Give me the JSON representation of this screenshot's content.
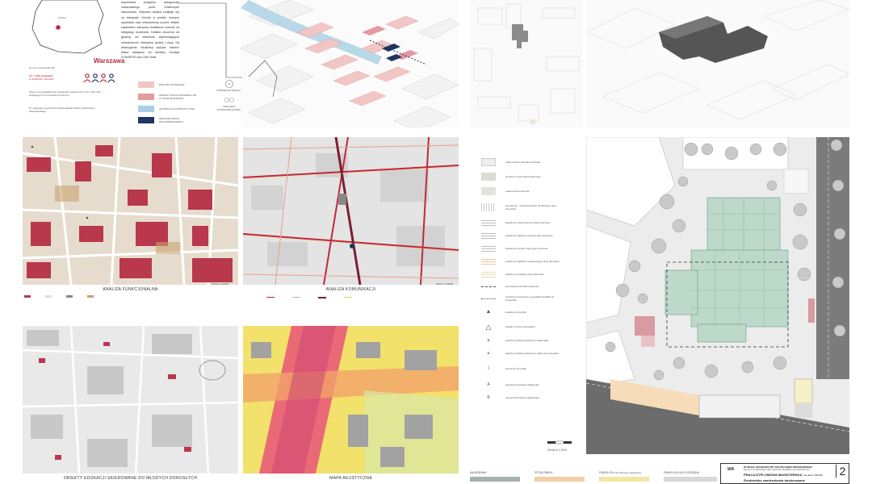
{
  "top_left": {
    "map_label_small": "Ochota",
    "city": "Warszawa",
    "stat_line1": "1k.3 tys. studentów UW",
    "stat_line2": "0,7 - 5,4% studentów",
    "stat_line3": "w spółdzielni członków*",
    "body_text": "dopełnianie programu dostępności realizowanego przez Uniwersytet Warszawski. Wybrana działka znajduje się na kampusie Ochota w pobliżu licznych wydziałów oraz infrastruktury uczelni. Bliskie sąsiedztwo zatrzyma dodatkowo pozwoli na integrację studentów. Działka otoczona od głównej osi założenia zapewniających mieszkańcom niezbędny spokój i ciszę. Na atrakcyjność lokalizacji wpływa również bliska odległość od siedziby fundacji SYNAPSIS oraz Ochi Teatr.",
    "footnote1": "*Dane o demograficznych studentach spadną od 0,7 do 7,5% osób studiujących na uczelniach wyższych.",
    "footnote2": "Dr. odkrywka na przeciwi studiów akademickich Uniwersytetu Warszawskiego.",
    "legend": [
      {
        "label": "BUDYNKI ISTNIEJĄCE",
        "color": "#f3c6c6"
      },
      {
        "label": "INWESTYCJE PLANOWANE LUB W TRAKCIE BUDOWY",
        "color": "#e39aa0"
      },
      {
        "label": "GŁÓWNA OŚ KOMPOZYCYJNA",
        "color": "#a9cfe4"
      },
      {
        "label": "MIEJSCE FORUM KRAJOBRAZOWEGO",
        "color": "#1e3560"
      }
    ],
    "legend_right": [
      {
        "label": "DRZEWA ISTNIEJĄCE"
      },
      {
        "label": "SZPALERY WYMAGANE W MPZP"
      }
    ]
  },
  "maps": [
    {
      "caption": "ANALIZA FUNKCJONALNA",
      "scale": "SKALA 1:10000"
    },
    {
      "caption": "ANALIZA KOMUNIKACJI",
      "scale": "SKALA 1:10000"
    },
    {
      "caption": "OBIEKTY EDUKACJI SKIEROWANE DO MŁODYCH DOROSŁYCH",
      "scale": ""
    },
    {
      "caption": "MAPA AKUSTYCZNA",
      "scale": ""
    }
  ],
  "site_legend": [
    "nawierzchnia mineralno-żwirowa",
    "chodnik z betonu akrologicznego",
    "nawierzchnia żwirowa",
    "ogrodzenie - stref kolorowych wbudowane płyty betonowe",
    "wejście do nowoczesnych płyty betonowe",
    "wejście do pawilonu wycisza płyty betonowe",
    "wejście do punktu wody płyty betonowe",
    "wejście do pawilonu edukacyjnego płyty betonowe",
    "wejście na stołówkę płyty betonowe",
    "wyznaczona ścieżka rowerowa",
    "oznaczenie betonowe w posadzce działka do studentów",
    "wejście do budynku",
    "wejście na teren kompleksu",
    "wjazd na parking podziemny akademika",
    "wjazd na parking podziemny zaburzony kompleks",
    "elementy informacji",
    "segment A budynku akademika",
    "segment B budynku akademika"
  ],
  "site_scale": "SKALA 1:500",
  "bottom_tabs": [
    {
      "label": "AKADEMIK",
      "color": "#a6b3ad"
    },
    {
      "label": "STOŁÓWKA",
      "color": "#f2cfa4"
    },
    {
      "label": "PAWILON",
      "sub": "informacyjno-edukacyjny",
      "color": "#f2e6a6"
    },
    {
      "label": "PAWILON WYCISZENIA",
      "color": "#d8d8d8"
    }
  ],
  "title_block": {
    "faculty": "WYDZIAŁ ARCHITEKTURY POLITECHNIKI WARSZAWSKIEJ",
    "faculty_en": "FACULTY OF ARCHITECTURE, WARSAW UNIVERSITY OF TECHNOLOGY",
    "work": "PRACA DYPLOMOWA MAGISTERSKA",
    "year": "rok akad. 2023/24",
    "subject": "Środowisko zamieszkania dostosowane",
    "sheet_no": "2"
  }
}
